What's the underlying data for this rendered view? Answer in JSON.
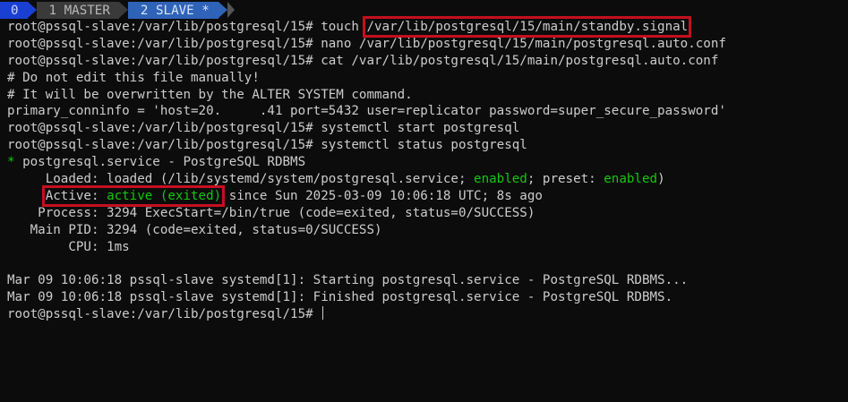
{
  "tabs": [
    {
      "number": "0",
      "name": ""
    },
    {
      "number": "1",
      "name": "MASTER"
    },
    {
      "number": "2",
      "name": "SLAVE *"
    }
  ],
  "terminal": {
    "prompt": "root@pssql-slave:/var/lib/postgresql/15# ",
    "line1_cmd": "touch ",
    "line1_arg": "/var/lib/postgresql/15/main/standby.signal",
    "line2_cmd": "nano /var/lib/postgresql/15/main/postgresql.auto.conf",
    "line3_cmd": "cat /var/lib/postgresql/15/main/postgresql.auto.conf",
    "conf_comment1": "# Do not edit this file manually!",
    "conf_comment2": "# It will be overwritten by the ALTER SYSTEM command.",
    "conf_primary": "primary_conninfo = 'host=20.     .41 port=5432 user=replicator password=super_secure_password'",
    "line7_cmd": "systemctl start postgresql",
    "line8_cmd": "systemctl status postgresql",
    "status_bullet": "*",
    "status_unit": " postgresql.service - PostgreSQL RDBMS",
    "loaded_prefix": "     Loaded: loaded (/lib/systemd/system/postgresql.service; ",
    "loaded_enabled1": "enabled",
    "loaded_mid": "; preset: ",
    "loaded_enabled2": "enabled",
    "loaded_suffix": ")",
    "active_indent": "     ",
    "active_label": "Active: ",
    "active_state": "active (exited)",
    "active_since": " since Sun 2025-03-09 10:06:18 UTC; 8s ago",
    "process": "    Process: 3294 ExecStart=/bin/true (code=exited, status=0/SUCCESS)",
    "mainpid": "   Main PID: 3294 (code=exited, status=0/SUCCESS)",
    "cpu": "        CPU: 1ms",
    "log1": "Mar 09 10:06:18 pssql-slave systemd[1]: Starting postgresql.service - PostgreSQL RDBMS...",
    "log2": "Mar 09 10:06:18 pssql-slave systemd[1]: Finished postgresql.service - PostgreSQL RDBMS."
  },
  "colors": {
    "background": "#0c0c0c",
    "foreground": "#cccccc",
    "green": "#16c60c",
    "highlight_box": "#c50f1f",
    "tab_active_0": "#1a3fd3",
    "tab_inactive": "#3a3a3a",
    "tab_current": "#2f63b8"
  }
}
